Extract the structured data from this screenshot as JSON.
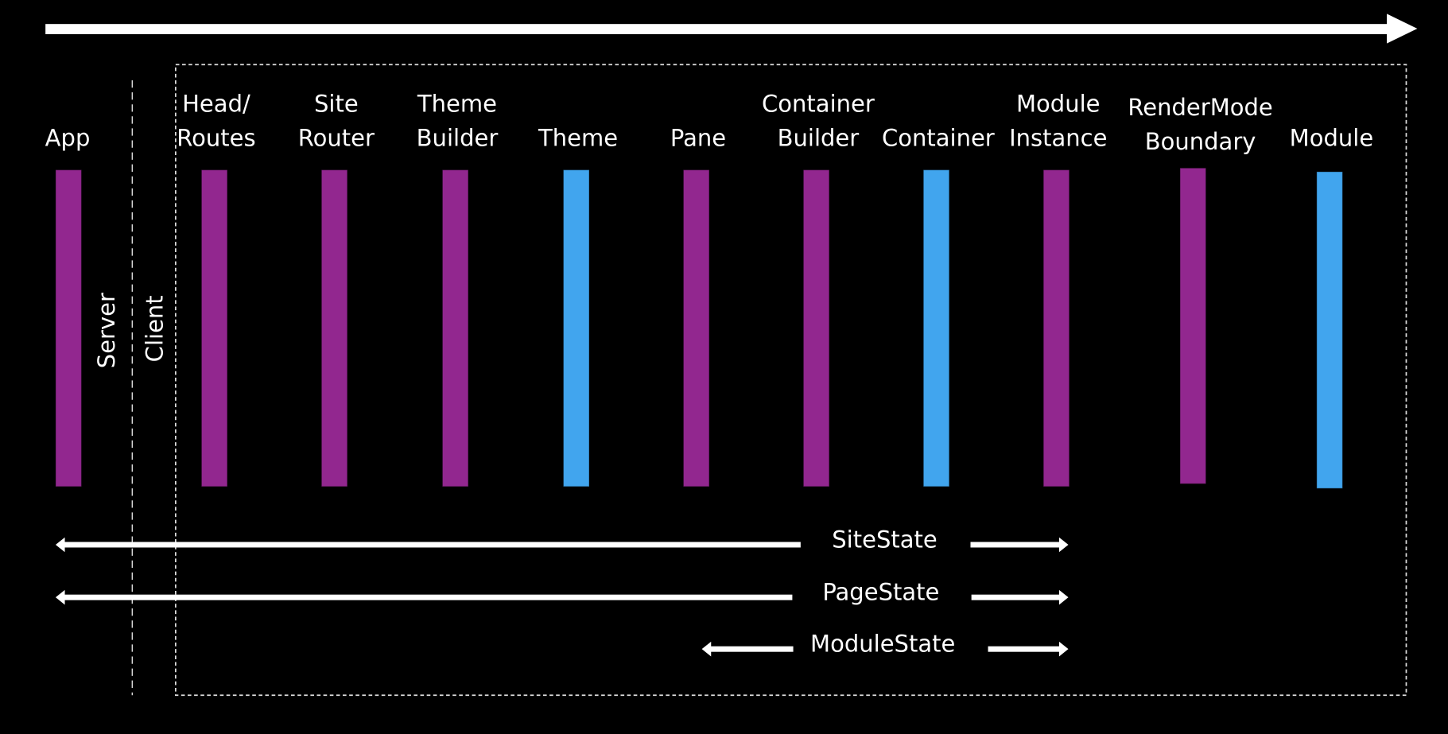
{
  "colors": {
    "background": "#000000",
    "purple": "#92278f",
    "blue": "#41a5ee",
    "line": "#ffffff"
  },
  "side_labels": {
    "server": "Server",
    "client": "Client"
  },
  "components": [
    {
      "lines": [
        "App"
      ],
      "color": "purple"
    },
    {
      "lines": [
        "Head/",
        "Routes"
      ],
      "color": "purple"
    },
    {
      "lines": [
        "Site",
        "Router"
      ],
      "color": "purple"
    },
    {
      "lines": [
        "Theme",
        "Builder"
      ],
      "color": "purple"
    },
    {
      "lines": [
        "Theme"
      ],
      "color": "blue"
    },
    {
      "lines": [
        "Pane"
      ],
      "color": "purple"
    },
    {
      "lines": [
        "Container",
        "Builder"
      ],
      "color": "purple"
    },
    {
      "lines": [
        "Container"
      ],
      "color": "blue"
    },
    {
      "lines": [
        "Module",
        "Instance"
      ],
      "color": "purple"
    },
    {
      "lines": [
        "RenderMode",
        "Boundary"
      ],
      "color": "purple"
    },
    {
      "lines": [
        "Module"
      ],
      "color": "blue"
    }
  ],
  "states": [
    {
      "label": "SiteState",
      "from": "App",
      "to": "Module"
    },
    {
      "label": "PageState",
      "from": "App",
      "to": "Module"
    },
    {
      "label": "ModuleState",
      "from": "Pane",
      "to": "Module"
    }
  ]
}
